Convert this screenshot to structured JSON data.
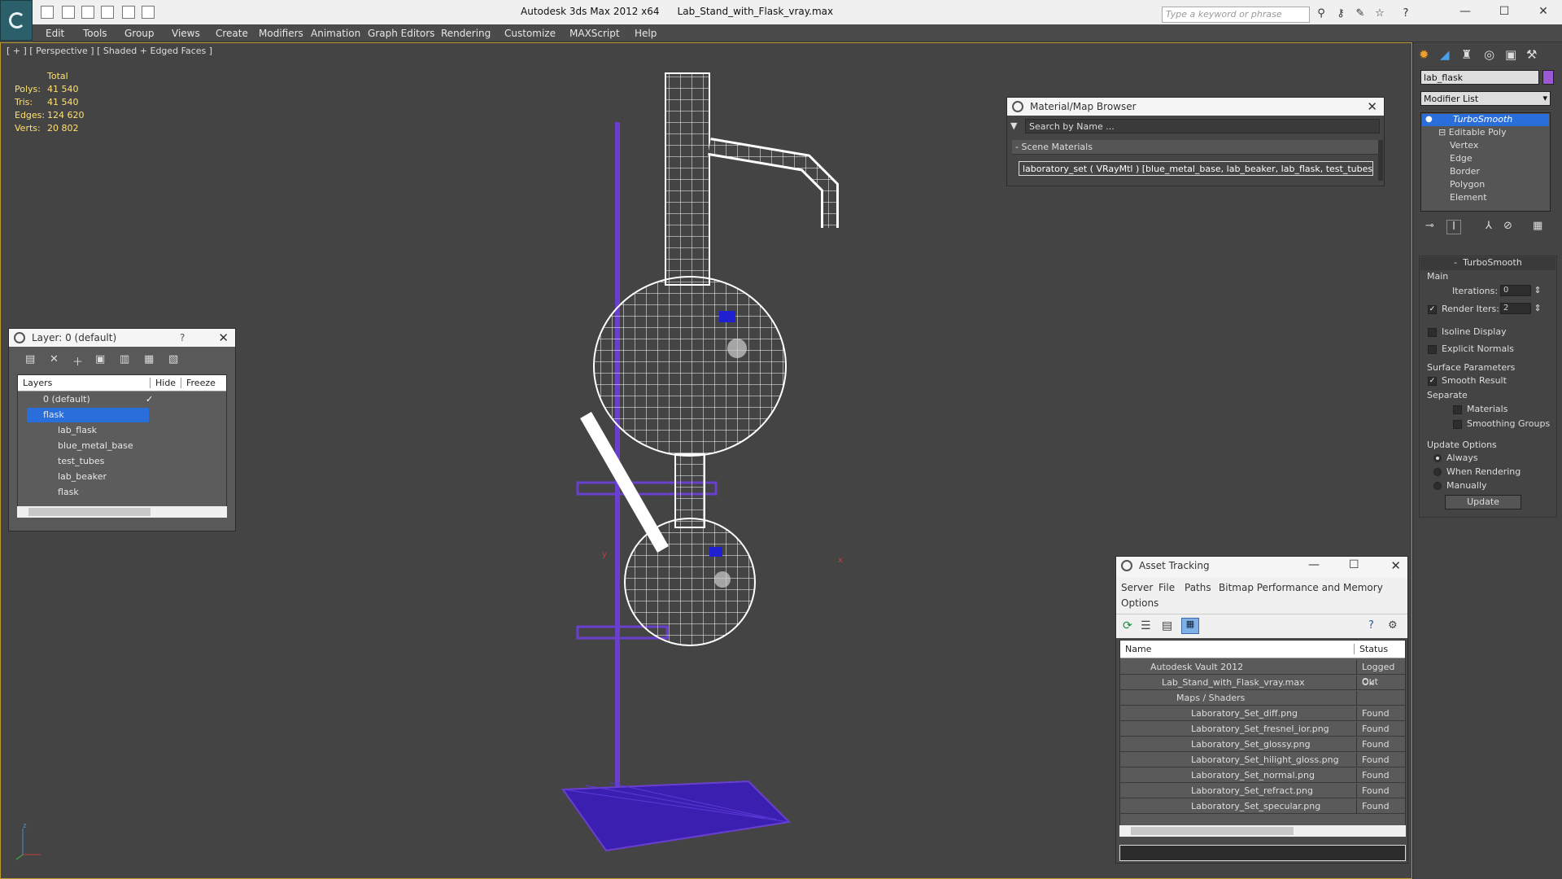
{
  "app": {
    "title": "Autodesk 3ds Max  2012 x64",
    "file": "Lab_Stand_with_Flask_vray.max",
    "search_placeholder": "Type a keyword or phrase"
  },
  "menu": [
    "Edit",
    "Tools",
    "Group",
    "Views",
    "Create",
    "Modifiers",
    "Animation",
    "Graph Editors",
    "Rendering",
    "Customize",
    "MAXScript",
    "Help"
  ],
  "viewport": {
    "label": "[ + ] [ Perspective ] [ Shaded + Edged Faces ]",
    "stats_header": "Total",
    "stats": [
      {
        "k": "Polys:",
        "v": "41 540"
      },
      {
        "k": "Tris:",
        "v": "41 540"
      },
      {
        "k": "Edges:",
        "v": "124 620"
      },
      {
        "k": "Verts:",
        "v": "20 802"
      }
    ],
    "axis_y": "y",
    "axis_x": "x",
    "gizmo_z": "z"
  },
  "layer_manager": {
    "title": "Layer: 0 (default)",
    "help": "?",
    "col_layers": "Layers",
    "col_hide": "Hide",
    "col_freeze": "Freeze",
    "rows": [
      {
        "name": "0 (default)",
        "indent": 0,
        "selected": false
      },
      {
        "name": "flask",
        "indent": 0,
        "selected": true
      },
      {
        "name": "lab_flask",
        "indent": 1,
        "selected": false
      },
      {
        "name": "blue_metal_base",
        "indent": 1,
        "selected": false
      },
      {
        "name": "test_tubes",
        "indent": 1,
        "selected": false
      },
      {
        "name": "lab_beaker",
        "indent": 1,
        "selected": false
      },
      {
        "name": "flask",
        "indent": 1,
        "selected": false
      }
    ]
  },
  "material_browser": {
    "title": "Material/Map Browser",
    "search": "Search by Name ...",
    "section": "Scene Materials",
    "item": "laboratory_set ( VRayMtl ) [blue_metal_base, lab_beaker, lab_flask, test_tubes]"
  },
  "asset_tracking": {
    "title": "Asset Tracking",
    "menu": [
      "Server",
      "File",
      "Paths",
      "Bitmap Performance and Memory",
      "Options"
    ],
    "col_name": "Name",
    "col_status": "Status",
    "rows": [
      {
        "name": "Autodesk Vault 2012",
        "status": "Logged Out",
        "indent": 1
      },
      {
        "name": "Lab_Stand_with_Flask_vray.max",
        "status": "Ok",
        "indent": 2
      },
      {
        "name": "Maps / Shaders",
        "status": "",
        "indent": 3
      },
      {
        "name": "Laboratory_Set_diff.png",
        "status": "Found",
        "indent": 4
      },
      {
        "name": "Laboratory_Set_fresnel_ior.png",
        "status": "Found",
        "indent": 4
      },
      {
        "name": "Laboratory_Set_glossy.png",
        "status": "Found",
        "indent": 4
      },
      {
        "name": "Laboratory_Set_hilight_gloss.png",
        "status": "Found",
        "indent": 4
      },
      {
        "name": "Laboratory_Set_normal.png",
        "status": "Found",
        "indent": 4
      },
      {
        "name": "Laboratory_Set_refract.png",
        "status": "Found",
        "indent": 4
      },
      {
        "name": "Laboratory_Set_specular.png",
        "status": "Found",
        "indent": 4
      }
    ]
  },
  "command_panel": {
    "object_name": "lab_flask",
    "object_color": "#9b59d6",
    "modifier_list": "Modifier List",
    "stack": [
      "TurboSmooth",
      "Editable Poly",
      "Vertex",
      "Edge",
      "Border",
      "Polygon",
      "Element"
    ],
    "rollout_title": "TurboSmooth",
    "main_label": "Main",
    "iterations_label": "Iterations:",
    "iterations_value": "0",
    "render_iters_label": "Render Iters:",
    "render_iters_value": "2",
    "isoline": "Isoline Display",
    "explicit": "Explicit Normals",
    "surface_label": "Surface Parameters",
    "smooth_result": "Smooth Result",
    "separate": "Separate",
    "materials": "Materials",
    "smoothing_groups": "Smoothing Groups",
    "update_options": "Update Options",
    "always": "Always",
    "when_rendering": "When Rendering",
    "manually": "Manually",
    "update_btn": "Update"
  }
}
